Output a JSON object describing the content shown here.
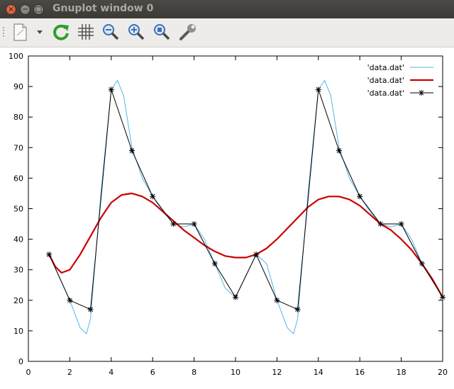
{
  "window": {
    "title": "Gnuplot window 0",
    "buttons": [
      "close",
      "minimize",
      "maximize"
    ]
  },
  "toolbar": {
    "items": [
      {
        "name": "copy-to-clipboard",
        "icon": "document-icon"
      },
      {
        "name": "export-menu",
        "icon": "chevron-down-icon"
      },
      {
        "name": "replot",
        "icon": "refresh-icon"
      },
      {
        "name": "toggle-grid",
        "icon": "grid-icon"
      },
      {
        "name": "zoom-previous",
        "icon": "zoom-out-icon"
      },
      {
        "name": "zoom-next",
        "icon": "zoom-in-icon"
      },
      {
        "name": "autoscale",
        "icon": "zoom-fit-icon"
      },
      {
        "name": "options",
        "icon": "wrench-icon"
      }
    ]
  },
  "colors": {
    "series_spline": "#56b4e9",
    "series_bezier": "#cc0000",
    "series_points": "#000000",
    "accent_green": "#2f9e2f"
  },
  "chart_data": {
    "type": "line",
    "title": "",
    "xlabel": "",
    "ylabel": "",
    "xlim": [
      0,
      20
    ],
    "ylim": [
      0,
      100
    ],
    "xticks": [
      0,
      2,
      4,
      6,
      8,
      10,
      12,
      14,
      16,
      18,
      20
    ],
    "yticks": [
      0,
      10,
      20,
      30,
      40,
      50,
      60,
      70,
      80,
      90,
      100
    ],
    "grid": false,
    "legend_position": "top-right",
    "series": [
      {
        "name": "'data.dat'",
        "style": "thin-line",
        "x": [
          1,
          2,
          2.5,
          2.8,
          3,
          3.5,
          4,
          4.3,
          4.6,
          5,
          5.5,
          6,
          6.5,
          7,
          7.5,
          8,
          8.5,
          9,
          9.5,
          10,
          10.5,
          11,
          11.5,
          12,
          12.5,
          12.8,
          13,
          13.5,
          14,
          14.3,
          14.6,
          15,
          15.5,
          16,
          16.5,
          17,
          17.5,
          18,
          18.5,
          19,
          19.5,
          20
        ],
        "y": [
          35,
          20,
          11,
          9,
          14,
          55,
          89,
          92,
          87,
          70,
          60,
          54,
          49,
          45,
          44,
          45,
          40,
          32,
          24,
          21,
          28,
          35,
          32,
          20,
          11,
          9,
          14,
          55,
          89,
          92,
          87,
          70,
          60,
          54,
          49,
          45,
          44,
          45,
          40,
          32,
          27,
          21
        ]
      },
      {
        "name": "'data.dat'",
        "style": "thick-line",
        "x": [
          1,
          1.3,
          1.6,
          2,
          2.5,
          3,
          3.5,
          4,
          4.5,
          5,
          5.5,
          6,
          6.5,
          7,
          7.5,
          8,
          8.5,
          9,
          9.5,
          10,
          10.5,
          11,
          11.5,
          12,
          12.5,
          13,
          13.5,
          14,
          14.5,
          15,
          15.5,
          16,
          16.5,
          17,
          17.5,
          18,
          18.5,
          19,
          19.5,
          20
        ],
        "y": [
          35,
          31,
          29,
          30,
          35,
          41,
          47,
          52,
          54.5,
          55,
          54,
          52,
          49,
          46,
          43,
          40.5,
          38,
          36,
          34.5,
          34,
          34,
          35,
          37,
          40,
          43.5,
          47,
          50.5,
          53,
          54,
          54,
          53,
          51,
          48,
          45,
          43,
          40,
          36.5,
          32,
          27,
          21
        ]
      },
      {
        "name": "'data.dat'",
        "style": "linespoints",
        "x": [
          1,
          2,
          3,
          4,
          5,
          6,
          7,
          8,
          9,
          10,
          11,
          12,
          13,
          14,
          15,
          16,
          17,
          18,
          19,
          20
        ],
        "y": [
          35,
          20,
          17,
          89,
          69,
          54,
          45,
          45,
          32,
          21,
          35,
          20,
          17,
          89,
          69,
          54,
          45,
          45,
          32,
          21
        ]
      }
    ]
  }
}
